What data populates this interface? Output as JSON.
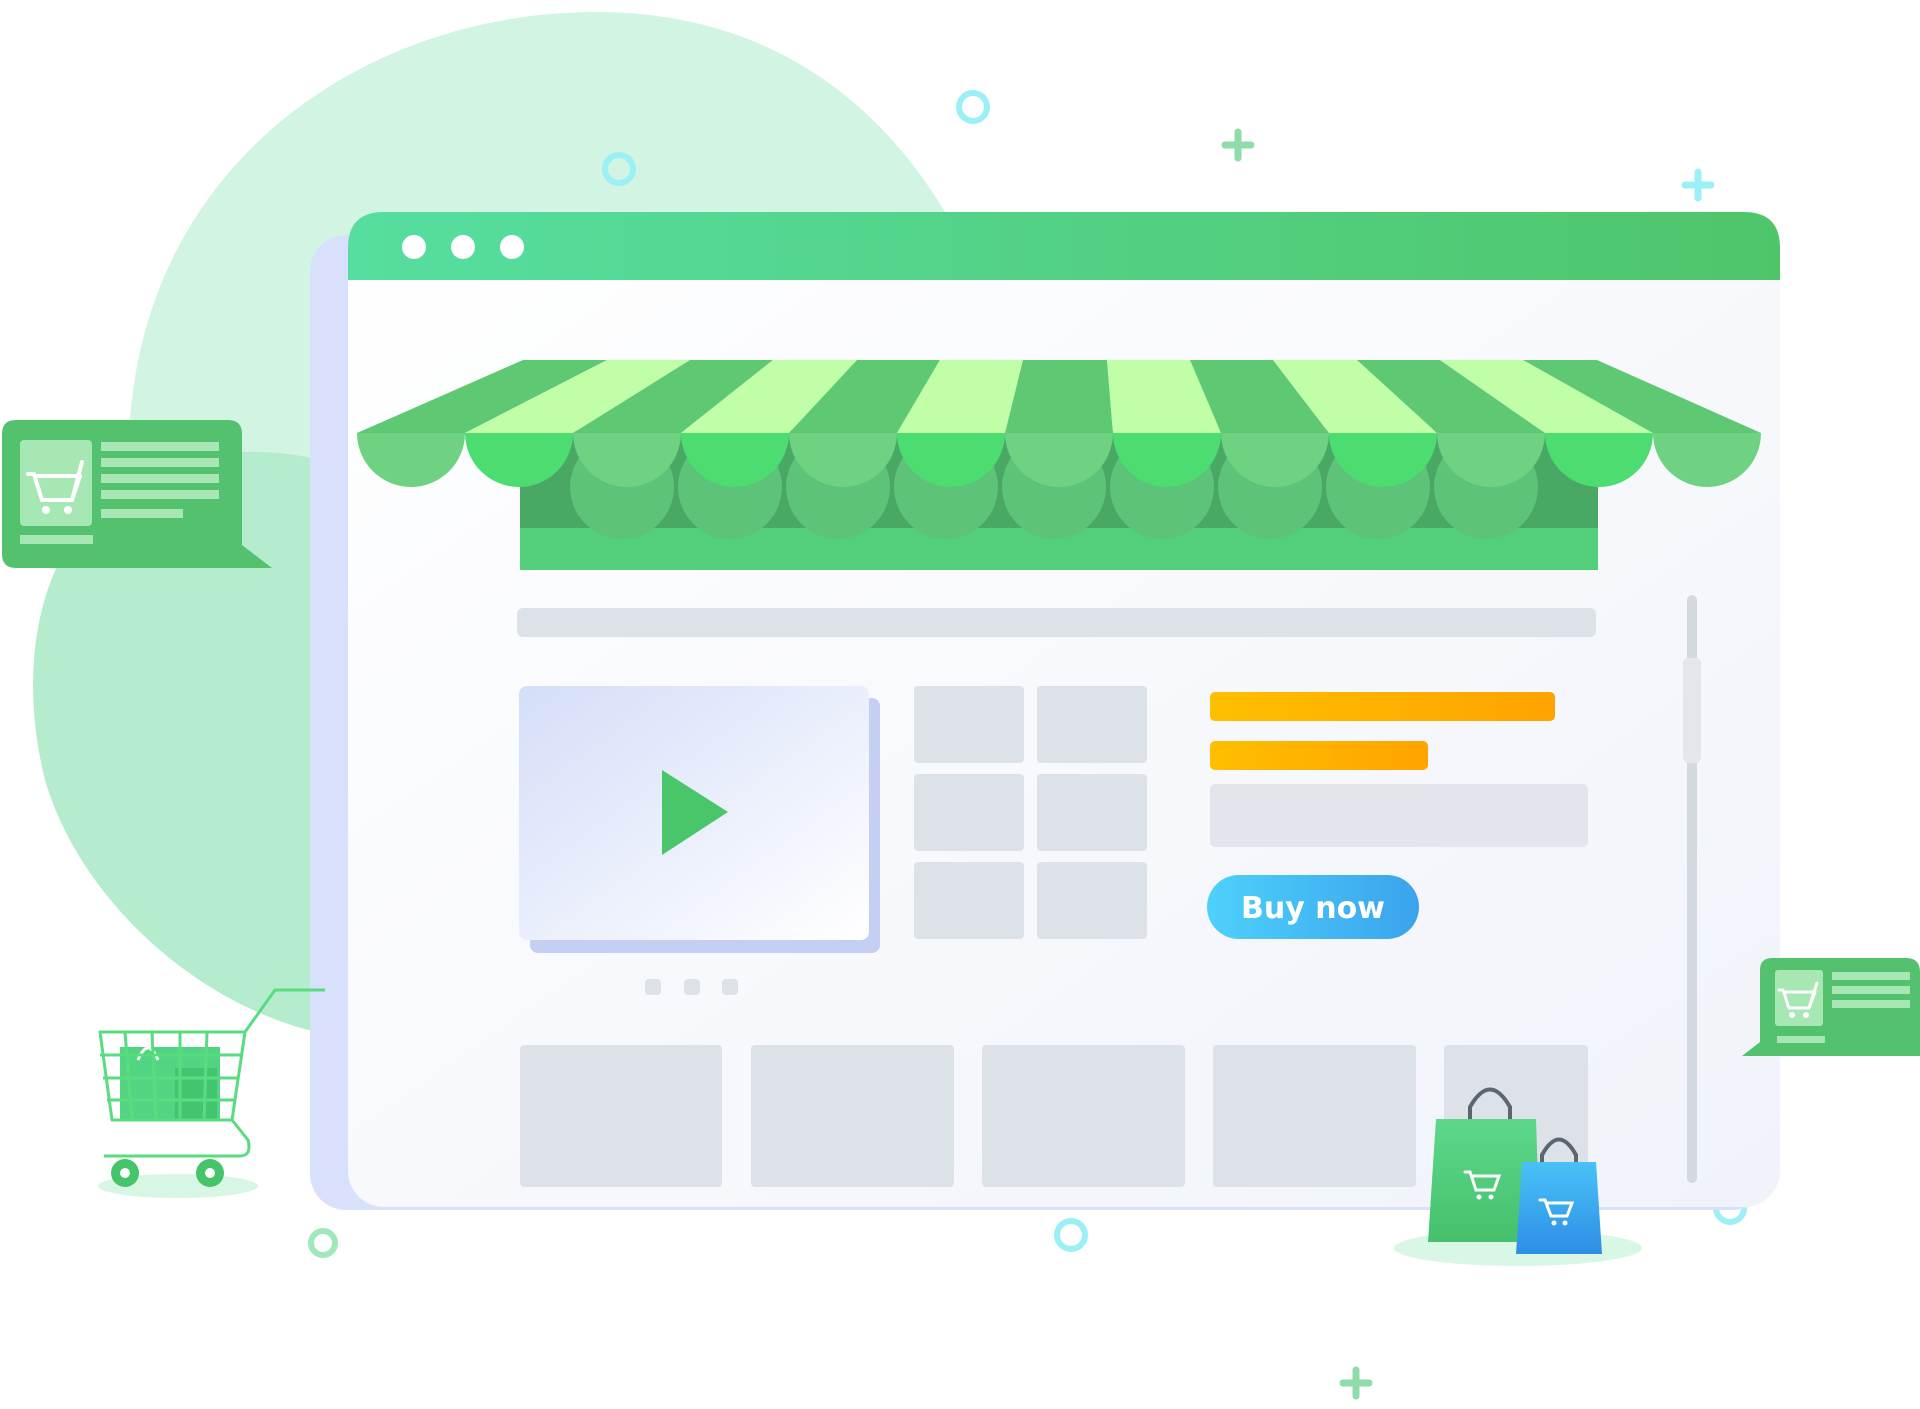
{
  "cta": {
    "label": "Buy now"
  },
  "colors": {
    "primary_green": "#55d48f",
    "dark_green": "#49a860",
    "light_mint": "#cdf3e0",
    "awning_light": "#c0ffa8",
    "cta_blue": "#3fb8f5",
    "accent_orange": "#ffad00",
    "placeholder_gray": "#dde2e8"
  },
  "icons": {
    "cart": "shopping-cart-icon",
    "play": "play-icon",
    "bag": "shopping-bag-icon"
  },
  "carousel": {
    "dots": 3,
    "active_index": 0
  },
  "window": {
    "control_dots": 3
  }
}
